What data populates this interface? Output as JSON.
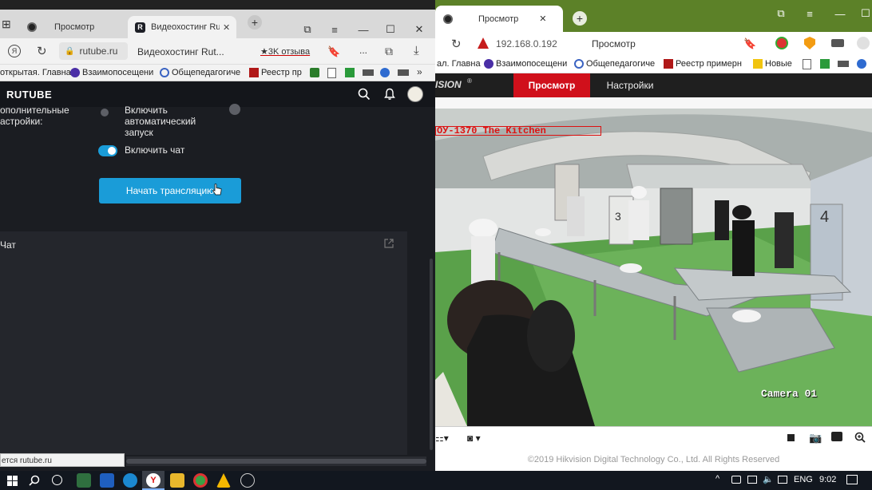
{
  "left_browser": {
    "tabs": [
      {
        "label": "Просмотр"
      },
      {
        "label": "Видеохостинг Rutu"
      }
    ],
    "address": {
      "domain": "rutube.ru",
      "page_title": "Видеохостинг Rut...",
      "reviews_badge": "★3K отзыва"
    },
    "bookmarks": [
      "открытая. Главна",
      "Взаимопосещени",
      "Общепедагогиче",
      "Реестр пр"
    ],
    "more_label": "..."
  },
  "rutube": {
    "logo": "RUTUBE",
    "settings_label": "ополнительные\nастройки:",
    "autostart_label": "Включить\nавтоматический\nзапуск",
    "chat_toggle_label": "Включить чат",
    "start_button": "Начать трансляцию",
    "chat_title": "Чат",
    "status_url": "ется rutube.ru",
    "colors": {
      "accent": "#1a9cd8",
      "toggle_on": "#1a9cd8"
    }
  },
  "right_browser": {
    "tab_label": "Просмотр",
    "address": {
      "ip": "192.168.0.192",
      "page_title": "Просмотр"
    },
    "bookmarks": [
      "ал. Главна",
      "Взаимопосещени",
      "Общепедагогиче",
      "Реестр примерн",
      "Новые"
    ],
    "hik_nav": {
      "brand": "ISION",
      "active_tab": "Просмотр",
      "other_tab": "Настройки",
      "active_color": "#d0101b"
    },
    "camera": {
      "overlay_text": "ОУ-1370 The Kitchen",
      "camera_label": "Camera 01",
      "numbers": [
        "3",
        "4"
      ]
    },
    "footer": "©2019 Hikvision Digital Technology Co., Ltd. All Rights Reserved"
  },
  "taskbar": {
    "language": "ENG",
    "time": "9:02"
  }
}
